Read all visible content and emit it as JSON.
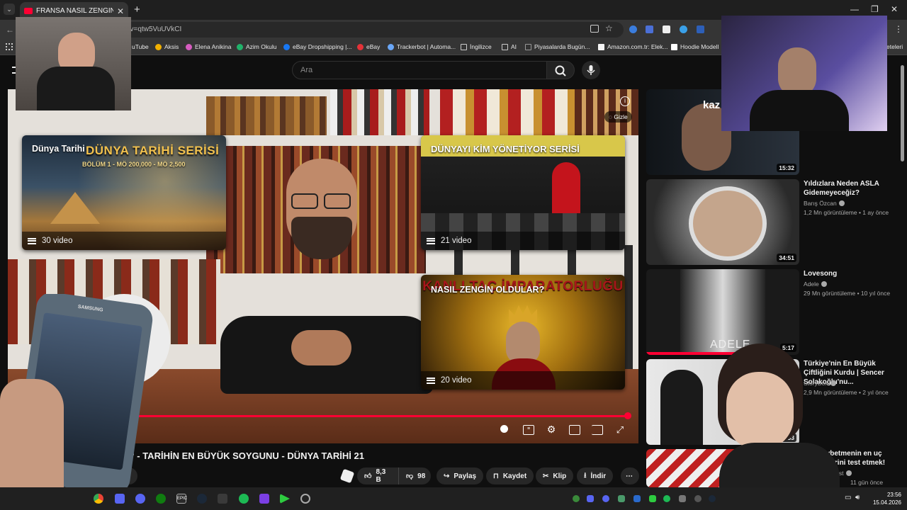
{
  "browser": {
    "tab_title": "FRANSA NASIL ZENGİN OLDU?",
    "url": "?v=qtw5VuUVkCI",
    "bookmarks": [
      "uTube",
      "Aksis",
      "Elena Anikina",
      "Azim Okulu",
      "eBay Dropshipping |...",
      "eBay",
      "Trackerbot | Automa...",
      "İngilizce",
      "AI",
      "Piyasalarda Bugün...",
      "Amazon.com.tr: Elek...",
      "Hoodie Modell",
      "eteleri"
    ]
  },
  "header": {
    "search_placeholder": "Ara"
  },
  "player": {
    "hide_label": "Gizle",
    "cards": [
      {
        "title": "Dünya Tarihi",
        "banner": "DÜNYA TARİHİ SERİSİ",
        "sub": "BÖLÜM 1 - MÖ 200,000 - MÖ 2,500",
        "count": "30 video"
      },
      {
        "title": "DÜNYAYI KİM YÖNETİYOR SERİSİ",
        "count": "21 video"
      },
      {
        "title": "NASIL ZENGİN OLDULAR?",
        "banner": "KANLI TAÇ İMPARATORLUĞU",
        "count": "20 video"
      }
    ],
    "progress": 0.984
  },
  "video": {
    "title": "LDU? - TARİHİN EN BÜYÜK SOYGUNU - DÜNYA TARİHİ 21",
    "sub_label": "ol",
    "likes": "8,3 B",
    "dislikes": "98",
    "share": "Paylaş",
    "save": "Kaydet",
    "clip": "Klip",
    "download": "İndir"
  },
  "related": [
    {
      "title": "",
      "channel": "",
      "meta": "",
      "duration": "15:32",
      "thumb_text": "kaz"
    },
    {
      "title": "Yıldızlara Neden ASLA Gidemeyeceğiz?",
      "channel": "Barış Özcan",
      "meta": "1,2 Mn görüntüleme • 1 ay önce",
      "duration": "34:51"
    },
    {
      "title": "Lovesong",
      "channel": "Adele",
      "meta": "29 Mn görüntüleme • 10 yıl önce",
      "duration": "5:17",
      "thumb_text": "ADELE"
    },
    {
      "title": "Türkiye'nin En Büyük Çiftliğini Kurdu | Sencer Solakoğlu'nu...",
      "channel": "StoryBox",
      "meta": "2,9 Mn görüntüleme • 2 yıl önce",
      "duration": "6:33"
    },
    {
      "title": "Yağ kaybetmenin en uç yöntemlerini test etmek!",
      "channel": "es West",
      "meta": "11 gün önce",
      "duration": ""
    }
  ],
  "taskbar": {
    "time": "23:56",
    "date": "15.04.2026"
  },
  "colors": {
    "accent": "#ff0033",
    "bg": "#0f0f0f"
  }
}
